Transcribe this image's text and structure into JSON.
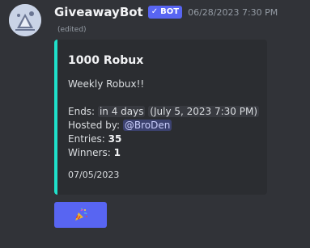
{
  "message": {
    "username": "GiveawayBot",
    "bot_tag": "BOT",
    "timestamp": "06/28/2023 7:30 PM",
    "edited": "(edited)"
  },
  "embed": {
    "accent_color": "#1fe0ca",
    "title": "1000 Robux",
    "description": "Weekly Robux!!",
    "ends_label": "Ends:",
    "ends_relative": "in 4 days",
    "ends_absolute": "July 5, 2023 7:30 PM",
    "hosted_label": "Hosted by:",
    "host_mention": "@BroDen",
    "entries_label": "Entries:",
    "entries_value": "35",
    "winners_label": "Winners:",
    "winners_value": "1",
    "footer_date": "07/05/2023"
  },
  "button": {
    "icon": "party-popper-icon",
    "color": "#5865f2"
  }
}
